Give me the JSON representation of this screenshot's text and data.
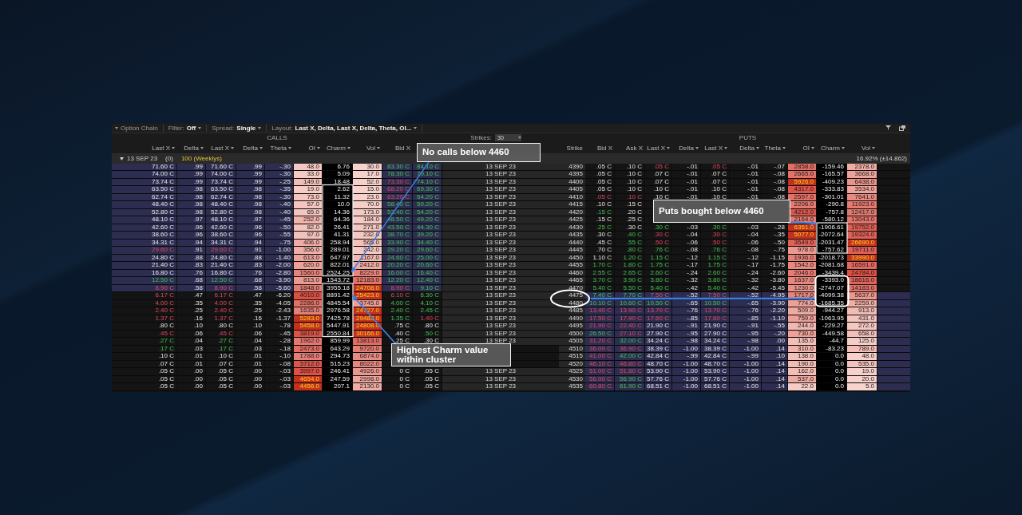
{
  "toolbar": {
    "title": "Option Chain",
    "items": [
      {
        "label": "Filter:",
        "value": "Off"
      },
      {
        "label": "Spread:",
        "value": "Single"
      },
      {
        "label": "Layout:",
        "value": "Last X, Delta, Last X, Delta, Theta, OI..."
      }
    ]
  },
  "sections": {
    "calls": "CALLS",
    "puts": "PUTS",
    "strikes_label": "Strikes:",
    "strikes_value": "30"
  },
  "calls_columns": [
    {
      "label": "Last X",
      "sortable": true
    },
    {
      "label": "Delta",
      "sortable": true
    },
    {
      "label": "Last X",
      "sortable": true
    },
    {
      "label": "Delta",
      "sortable": true
    },
    {
      "label": "Theta",
      "sortable": true
    },
    {
      "label": "OI",
      "sortable": true
    },
    {
      "label": "Charm",
      "sortable": true
    },
    {
      "label": "Vol",
      "sortable": true
    },
    {
      "label": "Bid X",
      "sortable": false
    }
  ],
  "strike_column": "Strike",
  "puts_columns": [
    {
      "label": "Bid X",
      "sortable": false
    },
    {
      "label": "Ask X",
      "sortable": false
    },
    {
      "label": "Last X",
      "sortable": true
    },
    {
      "label": "Delta",
      "sortable": true
    },
    {
      "label": "Last X",
      "sortable": true
    },
    {
      "label": "Delta",
      "sortable": true
    },
    {
      "label": "Theta",
      "sortable": true
    },
    {
      "label": "OI",
      "sortable": true
    },
    {
      "label": "Charm",
      "sortable": true
    },
    {
      "label": "Vol",
      "sortable": true
    }
  ],
  "group": {
    "expiry": "13 SEP 23",
    "count": "(0)",
    "series": "100 (Weeklys)",
    "expanded": true,
    "implied_move": "16.92% (±14.862)"
  },
  "rows": [
    {
      "strike": "4390",
      "expiry": "13 SEP 23",
      "calls_in_the_money": true,
      "calls": {
        "last_x": "71.60 C",
        "delta": ".99",
        "last_x_2": "71.60 C",
        "delta_2": ".99",
        "theta": "-.30",
        "oi": "48.0",
        "charm": "6.76",
        "vol": "30.0",
        "bid_x": {
          "text": "83.30 C",
          "up": true
        },
        "ask_x": {
          "text": "84.10 C",
          "up": true
        }
      },
      "puts": {
        "bid_x": ".05 C",
        "ask_x": ".10 C",
        "last_x": {
          "text": ".05 C",
          "up": false
        },
        "delta": "-.01",
        "last_x_2": {
          "text": ".05 C",
          "up": false
        },
        "delta_2": "-.01",
        "theta": "-.07",
        "oi": "2858.0",
        "charm": "-159.46",
        "vol": "2378.0"
      }
    },
    {
      "strike": "4395",
      "expiry": "13 SEP 23",
      "calls_in_the_money": true,
      "calls": {
        "last_x": "74.00 C",
        "delta": ".99",
        "last_x_2": "74.00 C",
        "delta_2": ".99",
        "theta": "-.30",
        "oi": "33.0",
        "charm": "5.09",
        "vol": "17.0",
        "bid_x": {
          "text": "78.30 C",
          "up": true
        },
        "ask_x": {
          "text": "79.10 C",
          "up": true
        }
      },
      "puts": {
        "bid_x": ".05 C",
        "ask_x": ".10 C",
        "last_x": ".07 C",
        "delta": "-.01",
        "last_x_2": ".07 C",
        "delta_2": "-.01",
        "theta": "-.08",
        "oi": "2665.0",
        "charm": "-165.57",
        "vol": "3668.0"
      }
    },
    {
      "strike": "4400",
      "expiry": "13 SEP 23",
      "calls_in_the_money": true,
      "calls": {
        "last_x": "73.74 C",
        "delta": ".99",
        "last_x_2": "73.74 C",
        "delta_2": ".99",
        "theta": "-.25",
        "oi": "149.0",
        "charm": "18.48",
        "vol": "52.0",
        "bid_x": {
          "text": "73.30 C",
          "up": false
        },
        "ask_x": {
          "text": "74.10 C",
          "up": true
        }
      },
      "puts": {
        "bid_x": ".05 C",
        "ask_x": ".10 C",
        "last_x": ".07 C",
        "delta": "-.01",
        "last_x_2": ".07 C",
        "delta_2": "-.01",
        "theta": "-.08",
        "oi": "5926.0",
        "charm": "-409.23",
        "vol": "6438.0"
      }
    },
    {
      "strike": "4405",
      "expiry": "13 SEP 23",
      "calls_in_the_money": true,
      "calls": {
        "last_x": "63.50 C",
        "delta": ".98",
        "last_x_2": "63.50 C",
        "delta_2": ".98",
        "theta": "-.35",
        "oi": "19.0",
        "charm": "2.62",
        "vol": "15.0",
        "bid_x": {
          "text": "68.20 C",
          "up": false
        },
        "ask_x": {
          "text": "69.30 C",
          "up": true
        }
      },
      "puts": {
        "bid_x": ".05 C",
        "ask_x": ".10 C",
        "last_x": ".10 C",
        "delta": "-.01",
        "last_x_2": ".10 C",
        "delta_2": "-.01",
        "theta": "-.08",
        "oi": "4317.0",
        "charm": "-333.83",
        "vol": "3534.0"
      }
    },
    {
      "strike": "4410",
      "expiry": "13 SEP 23",
      "calls_in_the_money": true,
      "calls": {
        "last_x": "62.74 C",
        "delta": ".98",
        "last_x_2": "62.74 C",
        "delta_2": ".98",
        "theta": "-.30",
        "oi": "73.0",
        "charm": "11.32",
        "vol": "23.0",
        "bid_x": {
          "text": "63.20 C",
          "up": false
        },
        "ask_x": {
          "text": "64.20 C",
          "up": true
        }
      },
      "puts": {
        "bid_x": {
          "text": ".05 C",
          "up": false
        },
        "ask_x": {
          "text": ".10 C",
          "up": false
        },
        "last_x": ".10 C",
        "delta": "-.01",
        "last_x_2": ".10 C",
        "delta_2": "-.01",
        "theta": "-.08",
        "oi": "2597.0",
        "charm": "-301.01",
        "vol": "7641.0"
      }
    },
    {
      "strike": "4415",
      "expiry": "13 SEP 23",
      "calls_in_the_money": true,
      "calls": {
        "last_x": "48.40 C",
        "delta": ".98",
        "last_x_2": "48.40 C",
        "delta_2": ".98",
        "theta": "-.40",
        "oi": "57.0",
        "charm": "10.0",
        "vol": "70.0",
        "bid_x": {
          "text": "58.40 C",
          "up": true
        },
        "ask_x": {
          "text": "59.20 C",
          "up": true
        }
      },
      "puts": {
        "bid_x": ".10 C",
        "ask_x": ".15 C",
        "oi": "2206.0",
        "charm": "-290.8",
        "vol": "11923.0"
      }
    },
    {
      "strike": "4420",
      "expiry": "13 SEP 23",
      "calls_in_the_money": true,
      "calls": {
        "last_x": "52.80 C",
        "delta": ".98",
        "last_x_2": "52.80 C",
        "delta_2": ".98",
        "theta": "-.40",
        "oi": "65.0",
        "charm": "14.36",
        "vol": "173.0",
        "bid_x": {
          "text": "53.40 C",
          "up": true
        },
        "ask_x": {
          "text": "54.20 C",
          "up": true
        }
      },
      "puts": {
        "bid_x": {
          "text": ".15 C",
          "up": true
        },
        "ask_x": ".20 C",
        "oi": "4212.0",
        "charm": "-757.8",
        "vol": "12417.0"
      }
    },
    {
      "strike": "4425",
      "expiry": "13 SEP 23",
      "calls_in_the_money": true,
      "calls": {
        "last_x": "48.10 C",
        "delta": ".97",
        "last_x_2": "48.10 C",
        "delta_2": ".97",
        "theta": "-.45",
        "oi": "252.0",
        "charm": "64.36",
        "vol": "184.0",
        "bid_x": {
          "text": "48.50 C",
          "up": true
        },
        "ask_x": {
          "text": "49.20 C",
          "up": true
        }
      },
      "puts": {
        "bid_x": ".15 C",
        "ask_x": ".25 C",
        "oi": "2164.0",
        "charm": "-580.12",
        "vol": "13043.0"
      }
    },
    {
      "strike": "4430",
      "expiry": "13 SEP 23",
      "calls_in_the_money": true,
      "calls": {
        "last_x": "42.60 C",
        "delta": ".96",
        "last_x_2": "42.60 C",
        "delta_2": ".96",
        "theta": "-.50",
        "oi": "82.0",
        "charm": "26.41",
        "vol": "271.0",
        "bid_x": {
          "text": "43.50 C",
          "up": true
        },
        "ask_x": {
          "text": "44.30 C",
          "up": true
        }
      },
      "puts": {
        "bid_x": {
          "text": ".25 C",
          "up": true
        },
        "ask_x": ".30 C",
        "last_x": {
          "text": ".30 C",
          "up": true
        },
        "delta": "-.03",
        "last_x_2": {
          "text": ".30 C",
          "up": true
        },
        "delta_2": "-.03",
        "theta": "-.28",
        "oi": "6351.0",
        "charm": "-1906.61",
        "vol": "19752.0"
      }
    },
    {
      "strike": "4435",
      "expiry": "13 SEP 23",
      "calls_in_the_money": true,
      "calls": {
        "last_x": "38.60 C",
        "delta": ".96",
        "last_x_2": "38.60 C",
        "delta_2": ".96",
        "theta": "-.55",
        "oi": "97.0",
        "charm": "41.31",
        "vol": "232.0",
        "bid_x": {
          "text": "38.70 C",
          "up": true
        },
        "ask_x": {
          "text": "39.20 C",
          "up": true
        }
      },
      "puts": {
        "bid_x": ".30 C",
        "ask_x": {
          "text": ".40 C",
          "up": true
        },
        "last_x": {
          "text": ".30 C",
          "up": false
        },
        "delta": "-.04",
        "last_x_2": {
          "text": ".30 C",
          "up": false
        },
        "delta_2": "-.04",
        "theta": "-.35",
        "oi": "5077.0",
        "charm": "-2072.64",
        "vol": "19324.0"
      }
    },
    {
      "strike": "4440",
      "expiry": "13 SEP 23",
      "calls_in_the_money": true,
      "calls": {
        "last_x": "34.31 C",
        "delta": ".94",
        "last_x_2": "34.31 C",
        "delta_2": ".94",
        "theta": "-.75",
        "oi": "406.0",
        "charm": "258.94",
        "vol": "565.0",
        "bid_x": {
          "text": "33.90 C",
          "up": true
        },
        "ask_x": {
          "text": "34.40 C",
          "up": true
        }
      },
      "puts": {
        "bid_x": ".45 C",
        "ask_x": {
          "text": ".55 C",
          "up": true
        },
        "last_x": {
          "text": ".50 C",
          "up": false
        },
        "delta": "-.06",
        "last_x_2": {
          "text": ".50 C",
          "up": false
        },
        "delta_2": "-.06",
        "theta": "-.50",
        "oi": "3549.0",
        "charm": "-2031.47",
        "vol": "26690.0"
      }
    },
    {
      "strike": "4445",
      "expiry": "13 SEP 23",
      "calls_in_the_money": true,
      "calls": {
        "last_x": {
          "text": "29.60 C",
          "up": false
        },
        "delta": ".91",
        "last_x_2": {
          "text": "29.60 C",
          "up": false
        },
        "delta_2": ".91",
        "theta": "-1.00",
        "oi": "356.0",
        "charm": "289.01",
        "vol": "242.0",
        "bid_x": {
          "text": "29.20 C",
          "up": true
        },
        "ask_x": {
          "text": "29.60 C",
          "up": true
        }
      },
      "puts": {
        "bid_x": ".70 C",
        "ask_x": {
          "text": ".80 C",
          "up": true
        },
        "last_x": {
          "text": ".76 C",
          "up": true
        },
        "delta": "-.08",
        "last_x_2": {
          "text": ".76 C",
          "up": true
        },
        "delta_2": "-.08",
        "theta": "-.75",
        "oi": "978.0",
        "charm": "-757.62",
        "vol": "19711.0"
      }
    },
    {
      "strike": "4450",
      "expiry": "13 SEP 23",
      "calls_in_the_money": true,
      "calls": {
        "last_x": "24.80 C",
        "delta": ".88",
        "last_x_2": "24.80 C",
        "delta_2": ".88",
        "theta": "-1.40",
        "oi": "613.0",
        "charm": "647.97",
        "vol": "1167.0",
        "bid_x": {
          "text": "24.60 C",
          "up": true
        },
        "ask_x": {
          "text": "25.00 C",
          "up": true
        }
      },
      "puts": {
        "bid_x": "1.10 C",
        "ask_x": {
          "text": "1.20 C",
          "up": true
        },
        "last_x": {
          "text": "1.15 C",
          "up": true
        },
        "delta": "-.12",
        "last_x_2": {
          "text": "1.15 C",
          "up": true
        },
        "delta_2": "-.12",
        "theta": "-1.15",
        "oi": "1936.0",
        "charm": "-2018.73",
        "vol": "33990.0"
      }
    },
    {
      "strike": "4455",
      "expiry": "13 SEP 23",
      "calls_in_the_money": true,
      "calls": {
        "last_x": "21.40 C",
        "delta": ".83",
        "last_x_2": "21.40 C",
        "delta_2": ".83",
        "theta": "-2.00",
        "oi": "620.0",
        "charm": "822.01",
        "vol": "2412.0",
        "bid_x": {
          "text": "20.20 C",
          "up": true
        },
        "ask_x": {
          "text": "20.60 C",
          "up": true
        }
      },
      "puts": {
        "bid_x": {
          "text": "1.70 C",
          "up": true
        },
        "ask_x": {
          "text": "1.80 C",
          "up": true
        },
        "last_x": {
          "text": "1.75 C",
          "up": true
        },
        "delta": "-.17",
        "last_x_2": {
          "text": "1.75 C",
          "up": true
        },
        "delta_2": "-.17",
        "theta": "-1.75",
        "oi": "1542.0",
        "charm": "-2081.68",
        "vol": "16591.0"
      }
    },
    {
      "strike": "4460",
      "expiry": "13 SEP 23",
      "calls_in_the_money": true,
      "calls": {
        "last_x": "16.80 C",
        "delta": ".76",
        "last_x_2": "16.80 C",
        "delta_2": ".76",
        "theta": "-2.80",
        "oi": "1560.0",
        "charm": "2524.25",
        "vol": "8229.0",
        "bid_x": {
          "text": "16.00 C",
          "up": true
        },
        "ask_x": {
          "text": "16.40 C",
          "up": true
        }
      },
      "puts": {
        "bid_x": {
          "text": "2.55 C",
          "up": true
        },
        "ask_x": {
          "text": "2.65 C",
          "up": true
        },
        "last_x": {
          "text": "2.60 C",
          "up": true
        },
        "delta": "-.24",
        "last_x_2": {
          "text": "2.60 C",
          "up": true
        },
        "delta_2": "-.24",
        "theta": "-2.60",
        "oi": "2046.0",
        "charm": "-3439.4",
        "vol": "24784.0"
      }
    },
    {
      "strike": "4465",
      "expiry": "13 SEP 23",
      "calls_in_the_money": true,
      "calls": {
        "last_x": {
          "text": "12.50 C",
          "up": true
        },
        "delta": ".68",
        "last_x_2": {
          "text": "12.50 C",
          "up": true
        },
        "delta_2": ".68",
        "theta": "-3.90",
        "oi": "813.0",
        "charm": "1543.72",
        "vol": "12183.0",
        "bid_x": {
          "text": "12.20 C",
          "up": true
        },
        "ask_x": {
          "text": "12.40 C",
          "up": true
        }
      },
      "puts": {
        "bid_x": {
          "text": "3.70 C",
          "up": true
        },
        "ask_x": {
          "text": "3.90 C",
          "up": true
        },
        "last_x": {
          "text": "3.80 C",
          "up": true
        },
        "delta": "-.32",
        "last_x_2": {
          "text": "3.80 C",
          "up": true
        },
        "delta_2": "-.32",
        "theta": "-3.80",
        "oi": "1637.0",
        "charm": "-3393.0",
        "vol": "18616.0"
      }
    },
    {
      "strike": "4470",
      "expiry": "13 SEP 23",
      "calls_in_the_money": true,
      "calls": {
        "last_x": {
          "text": "8.90 C",
          "up": false
        },
        "delta": ".58",
        "last_x_2": {
          "text": "8.90 C",
          "up": false
        },
        "delta_2": ".58",
        "theta": "-5.60",
        "oi": "1848.0",
        "charm": "3955.18",
        "vol": "24708.0",
        "bid_x": {
          "text": "8.90 C",
          "up": false
        },
        "ask_x": {
          "text": "9.10 C",
          "up": true
        }
      },
      "puts": {
        "bid_x": {
          "text": "5.40 C",
          "up": true
        },
        "ask_x": {
          "text": "5.50 C",
          "up": true
        },
        "last_x": {
          "text": "5.40 C",
          "up": true
        },
        "delta": "-.42",
        "last_x_2": {
          "text": "5.40 C",
          "up": true
        },
        "delta_2": "-.42",
        "theta": "-5.45",
        "oi": "1230.0",
        "charm": "-2747.07",
        "vol": "14183.0"
      }
    },
    {
      "strike": "4475",
      "expiry": "13 SEP 23",
      "calls_in_the_money": false,
      "calls": {
        "last_x": {
          "text": "6.17 C",
          "up": false
        },
        "delta": ".47",
        "last_x_2": {
          "text": "6.17 C",
          "up": false
        },
        "delta_2": ".47",
        "theta": "-6.20",
        "oi": "4010.0",
        "charm": "8891.42",
        "vol": "25423.0",
        "bid_x": {
          "text": "6.10 C",
          "up": false
        },
        "ask_x": {
          "text": "6.30 C",
          "up": true
        }
      },
      "puts": {
        "bid_x": {
          "text": "7.40 C",
          "up": true
        },
        "ask_x": {
          "text": "7.70 C",
          "up": true
        },
        "last_x": {
          "text": "7.50 C",
          "up": false
        },
        "delta": "-.52",
        "last_x_2": {
          "text": "7.50 C",
          "up": false
        },
        "delta_2": "-.52",
        "theta": "-4.95",
        "oi": "1717.0",
        "charm": "-4099.38",
        "vol": "5637.0"
      }
    },
    {
      "strike": "4480",
      "expiry": "13 SEP 23",
      "calls_in_the_money": false,
      "calls": {
        "last_x": {
          "text": "4.00 C",
          "up": false
        },
        "delta": ".35",
        "last_x_2": {
          "text": "4.00 C",
          "up": false
        },
        "delta_2": ".35",
        "theta": "-4.05",
        "oi": "2286.0",
        "charm": "4845.54",
        "vol": "3745.0",
        "bid_x": {
          "text": "4.00 C",
          "up": true
        },
        "ask_x": {
          "text": "4.10 C",
          "up": true
        }
      },
      "puts": {
        "bid_x": {
          "text": "10.10 C",
          "up": true
        },
        "ask_x": {
          "text": "10.60 C",
          "up": true
        },
        "last_x": {
          "text": "10.50 C",
          "up": true
        },
        "delta": "-.65",
        "last_x_2": {
          "text": "10.50 C",
          "up": true
        },
        "delta_2": "-.65",
        "theta": "-3.90",
        "oi": "774.0",
        "charm": "-1685.35",
        "vol": "2259.0"
      }
    },
    {
      "strike": "4485",
      "expiry": "13 SEP 23",
      "calls_in_the_money": false,
      "calls": {
        "last_x": {
          "text": "2.40 C",
          "up": false
        },
        "delta": ".25",
        "last_x_2": {
          "text": "2.40 C",
          "up": false
        },
        "delta_2": ".25",
        "theta": "-2.43",
        "oi": "1635.0",
        "charm": "2976.58",
        "vol": "24727.0",
        "bid_x": {
          "text": "2.40 C",
          "up": true
        },
        "ask_x": {
          "text": "2.45 C",
          "up": true
        }
      },
      "puts": {
        "bid_x": {
          "text": "13.40 C",
          "up": false
        },
        "ask_x": {
          "text": "13.90 C",
          "up": false
        },
        "last_x": {
          "text": "13.70 C",
          "up": false
        },
        "delta": "-.76",
        "last_x_2": {
          "text": "13.70 C",
          "up": false
        },
        "delta_2": "-.76",
        "theta": "-2.20",
        "oi": "509.0",
        "charm": "-944.27",
        "vol": "913.0"
      }
    },
    {
      "strike": "4490",
      "expiry": "13 SEP 23",
      "calls_in_the_money": false,
      "calls": {
        "last_x": {
          "text": "1.37 C",
          "up": false
        },
        "delta": ".16",
        "last_x_2": {
          "text": "1.37 C",
          "up": false
        },
        "delta_2": ".16",
        "theta": "-1.37",
        "oi": "5283.0",
        "charm": "7425.78",
        "vol": "29483.0",
        "bid_x": {
          "text": "1.35 C",
          "up": true
        },
        "ask_x": {
          "text": "1.40 C",
          "up": false
        }
      },
      "puts": {
        "bid_x": {
          "text": "17.50 C",
          "up": false
        },
        "ask_x": {
          "text": "17.90 C",
          "up": false
        },
        "last_x": {
          "text": "17.60 C",
          "up": false
        },
        "delta": "-.85",
        "last_x_2": {
          "text": "17.60 C",
          "up": false
        },
        "delta_2": "-.85",
        "theta": "-1.10",
        "oi": "759.0",
        "charm": "-1063.95",
        "vol": "431.0"
      }
    },
    {
      "strike": "4495",
      "expiry": "13 SEP 23",
      "calls_in_the_money": false,
      "calls": {
        "last_x": ".80 C",
        "delta": ".10",
        "last_x_2": ".80 C",
        "delta_2": ".10",
        "theta": "-.78",
        "oi": "5458.0",
        "charm": "5447.91",
        "vol": "24808.0",
        "bid_x": ".75 C",
        "ask_x": ".80 C"
      },
      "puts": {
        "bid_x": {
          "text": "21.90 C",
          "up": false
        },
        "ask_x": {
          "text": "22.40 C",
          "up": false
        },
        "last_x": "21.90 C",
        "delta": "-.91",
        "last_x_2": "21.90 C",
        "delta_2": "-.91",
        "theta": "-.55",
        "oi": "244.0",
        "charm": "-229.27",
        "vol": "272.0"
      }
    },
    {
      "strike": "4500",
      "expiry": "13 SEP 23",
      "calls_in_the_money": false,
      "calls": {
        "last_x": {
          "text": ".45 C",
          "up": false
        },
        "delta": ".06",
        "last_x_2": {
          "text": ".45 C",
          "up": false
        },
        "delta_2": ".06",
        "theta": "-.45",
        "oi": "3819.0",
        "charm": "2550.84",
        "vol": "30166.0",
        "bid_x": ".40 C",
        "ask_x": {
          "text": ".50 C",
          "up": true
        }
      },
      "puts": {
        "bid_x": {
          "text": "26.50 C",
          "up": true
        },
        "ask_x": {
          "text": "27.10 C",
          "up": false
        },
        "last_x": "27.90 C",
        "delta": "-.95",
        "last_x_2": "27.90 C",
        "delta_2": "-.95",
        "theta": "-.20",
        "oi": "730.0",
        "charm": "-449.58",
        "vol": "658.0"
      }
    },
    {
      "strike": "4505",
      "expiry": "13 SEP 23",
      "calls_in_the_money": false,
      "calls": {
        "last_x": {
          "text": ".27 C",
          "up": true
        },
        "delta": ".04",
        "last_x_2": {
          "text": ".27 C",
          "up": true
        },
        "delta_2": ".04",
        "theta": "-.28",
        "oi": "1962.0",
        "charm": "859.99",
        "vol": "13813.0",
        "bid_x": ".25 C",
        "ask_x": ".30 C"
      },
      "puts": {
        "bid_x": {
          "text": "31.20 C",
          "up": false
        },
        "ask_x": {
          "text": "32.00 C",
          "up": true
        },
        "last_x": "34.24 C",
        "delta": "-.98",
        "last_x_2": "34.24 C",
        "delta_2": "-.98",
        "theta": ".00",
        "oi": "135.0",
        "charm": "-44.7",
        "vol": "125.0"
      }
    },
    {
      "strike": "4510",
      "calls_in_the_money": false,
      "calls": {
        "last_x": {
          "text": ".17 C",
          "up": true
        },
        "delta": ".03",
        "last_x_2": {
          "text": ".17 C",
          "up": true
        },
        "delta_2": ".03",
        "theta": "-.18",
        "oi": "2473.0",
        "charm": "643.29",
        "vol": "9720.0"
      },
      "puts": {
        "bid_x": {
          "text": "36.00 C",
          "up": false
        },
        "ask_x": {
          "text": "36.90 C",
          "up": false
        },
        "last_x": "38.39 C",
        "delta": "-1.00",
        "last_x_2": "38.39 C",
        "delta_2": "-1.00",
        "theta": ".14",
        "oi": "310.0",
        "charm": "-83.23",
        "vol": "789.0"
      }
    },
    {
      "strike": "4515",
      "calls_in_the_money": false,
      "calls": {
        "last_x": ".10 C",
        "delta": ".01",
        "last_x_2": ".10 C",
        "delta_2": ".01",
        "theta": "-.10",
        "oi": "1788.0",
        "charm": "294.73",
        "vol": "6874.0"
      },
      "puts": {
        "bid_x": {
          "text": "41.00 C",
          "up": false
        },
        "ask_x": {
          "text": "42.00 C",
          "up": true
        },
        "last_x": "42.84 C",
        "delta": "-.99",
        "last_x_2": "42.84 C",
        "delta_2": "-.99",
        "theta": ".10",
        "oi": "138.0",
        "charm": "0.0",
        "vol": "48.0"
      }
    },
    {
      "strike": "4520",
      "calls_in_the_money": false,
      "calls": {
        "last_x": ".07 C",
        "delta": ".01",
        "last_x_2": ".07 C",
        "delta_2": ".01",
        "theta": "-.08",
        "oi": "3712.0",
        "charm": "515.23",
        "vol": "8022.0"
      },
      "puts": {
        "bid_x": {
          "text": "46.10 C",
          "up": false
        },
        "ask_x": {
          "text": "46.80 C",
          "up": false
        },
        "last_x": "48.70 C",
        "delta": "-1.00",
        "last_x_2": "48.70 C",
        "delta_2": "-1.00",
        "theta": ".14",
        "oi": "190.0",
        "charm": "0.0",
        "vol": "535.0"
      }
    },
    {
      "strike": "4525",
      "expiry": "13 SEP 23",
      "calls_in_the_money": false,
      "calls": {
        "last_x": ".05 C",
        "delta": ".00",
        "last_x_2": ".05 C",
        "delta_2": ".00",
        "theta": "-.03",
        "oi": "3997.0",
        "charm": "246.41",
        "vol": "4926.0",
        "bid_x": "0 C",
        "ask_x": ".05 C"
      },
      "puts": {
        "bid_x": {
          "text": "51.00 C",
          "up": false
        },
        "ask_x": {
          "text": "51.80 C",
          "up": false
        },
        "last_x": "53.90 C",
        "delta": "-1.00",
        "last_x_2": "53.90 C",
        "delta_2": "-1.00",
        "theta": ".14",
        "oi": "162.0",
        "charm": "0.0",
        "vol": "19.0"
      }
    },
    {
      "strike": "4530",
      "expiry": "13 SEP 23",
      "calls_in_the_money": false,
      "calls": {
        "last_x": ".05 C",
        "delta": ".00",
        "last_x_2": ".05 C",
        "delta_2": ".00",
        "theta": "-.03",
        "oi": "4654.0",
        "charm": "247.59",
        "vol": "2998.0",
        "bid_x": "0 C",
        "ask_x": ".05 C"
      },
      "puts": {
        "bid_x": {
          "text": "56.00 C",
          "up": false
        },
        "ask_x": {
          "text": "56.90 C",
          "up": true
        },
        "last_x": "57.76 C",
        "delta": "-1.00",
        "last_x_2": "57.76 C",
        "delta_2": "-1.00",
        "theta": ".14",
        "oi": "537.0",
        "charm": "0.0",
        "vol": "20.0"
      }
    },
    {
      "strike": "4535",
      "expiry": "13 SEP 23",
      "calls_in_the_money": false,
      "calls": {
        "last_x": ".05 C",
        "delta": ".00",
        "last_x_2": ".05 C",
        "delta_2": ".00",
        "theta": "-.03",
        "oi": "4456.0",
        "charm": "207.1",
        "vol": "2130.0",
        "bid_x": "0 C",
        "ask_x": ".05 C"
      },
      "puts": {
        "bid_x": {
          "text": "60.80 C",
          "up": false
        },
        "ask_x": {
          "text": "61.90 C",
          "up": true
        },
        "last_x": "68.51 C",
        "delta": "-1.00",
        "last_x_2": "68.51 C",
        "delta_2": "-1.00",
        "theta": ".14",
        "oi": "22.0",
        "charm": "0.0",
        "vol": "5.0"
      }
    }
  ],
  "callouts": [
    {
      "text": "No calls below 4460"
    },
    {
      "text": "Highest Charm value within cluster"
    },
    {
      "text": "Puts bought below 4460"
    }
  ]
}
